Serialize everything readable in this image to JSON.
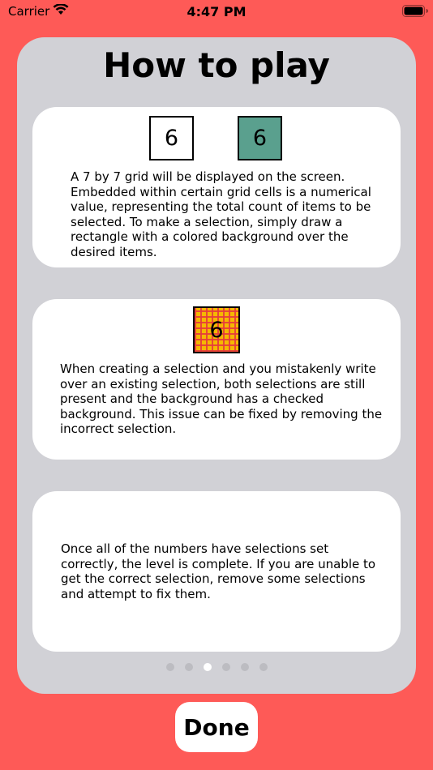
{
  "status_bar": {
    "carrier": "Carrier",
    "time": "4:47 PM",
    "wifi_icon": "wifi-icon",
    "battery_icon": "battery-icon"
  },
  "panel": {
    "title": "How to play",
    "cards": [
      {
        "tiles": [
          {
            "label": "6",
            "style": "plain"
          },
          {
            "label": "6",
            "style": "selected",
            "color": "#5AA08E"
          }
        ],
        "text": "A 7 by 7 grid will be displayed on the screen. Embedded within certain grid cells is a numerical value, representing the total count of items to be selected. To make a selection, simply draw a rectangle with a colored background over the desired items."
      },
      {
        "tiles": [
          {
            "label": "6",
            "style": "checked",
            "color": "#F5B800"
          }
        ],
        "text": "When creating a selection and you mistakenly write over an existing selection, both selections are still present and the background has a checked background. This issue can be fixed by removing the incorrect selection."
      },
      {
        "tiles": [],
        "text": "Once all of the numbers have selections set correctly,  the level is complete.  If you are unable to get the correct selection, remove some selections and attempt to fix them."
      }
    ]
  },
  "page_indicator": {
    "count": 6,
    "current_index": 2
  },
  "done_button": {
    "label": "Done"
  },
  "colors": {
    "background": "#FE5A57",
    "panel": "#D1D1D6",
    "card": "#FFFFFF"
  }
}
